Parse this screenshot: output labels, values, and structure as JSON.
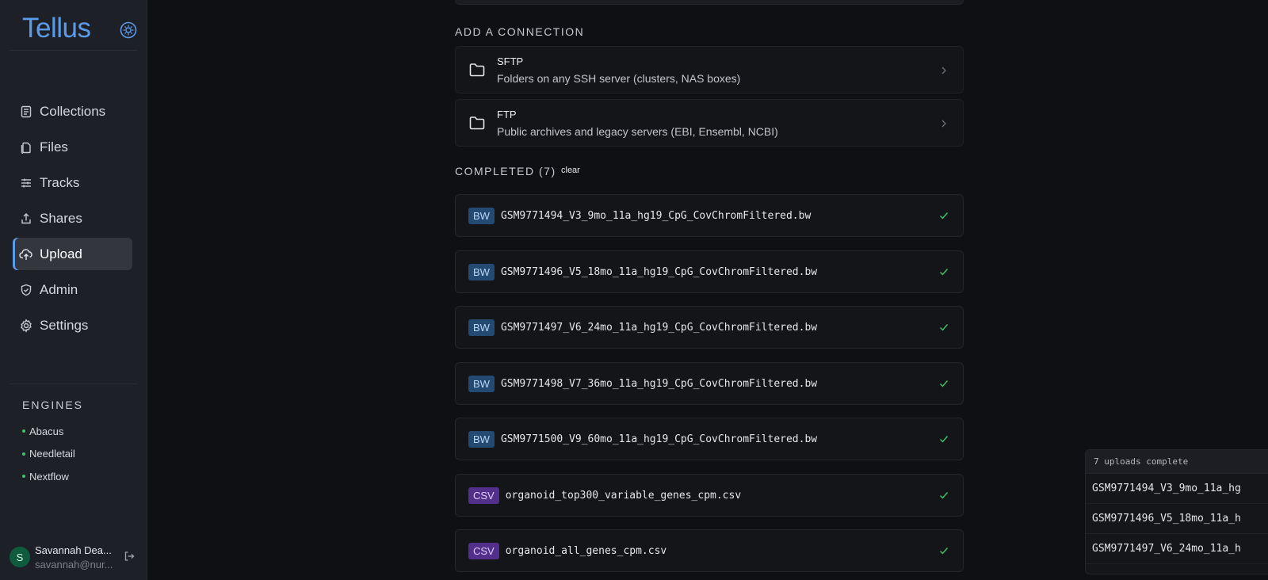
{
  "app": {
    "name": "Tellus"
  },
  "sidebar": {
    "nav": [
      {
        "label": "Collections",
        "icon": "collections-icon",
        "active": false
      },
      {
        "label": "Files",
        "icon": "files-icon",
        "active": false
      },
      {
        "label": "Tracks",
        "icon": "tracks-icon",
        "active": false
      },
      {
        "label": "Shares",
        "icon": "share-icon",
        "active": false
      },
      {
        "label": "Upload",
        "icon": "upload-cloud-icon",
        "active": true
      },
      {
        "label": "Admin",
        "icon": "shield-icon",
        "active": false
      },
      {
        "label": "Settings",
        "icon": "gear-icon",
        "active": false
      }
    ],
    "engines_title": "ENGINES",
    "engines": [
      "Abacus",
      "Needletail",
      "Nextflow"
    ],
    "user": {
      "initial": "S",
      "name": "Savannah Dea...",
      "email": "savannah@nur..."
    }
  },
  "main": {
    "add_connection_title": "ADD A CONNECTION",
    "connections": [
      {
        "title": "SFTP",
        "description": "Folders on any SSH server (clusters, NAS boxes)",
        "icon": "folder-icon"
      },
      {
        "title": "FTP",
        "description": "Public archives and legacy servers (EBI, Ensembl, NCBI)",
        "icon": "folder-icon"
      }
    ],
    "completed_title": "COMPLETED (7)",
    "clear_label": "clear",
    "files": [
      {
        "type": "BW",
        "name": "GSM9771494_V3_9mo_11a_hg19_CpG_CovChromFiltered.bw",
        "status": "check-icon"
      },
      {
        "type": "BW",
        "name": "GSM9771496_V5_18mo_11a_hg19_CpG_CovChromFiltered.bw",
        "status": "check-icon"
      },
      {
        "type": "BW",
        "name": "GSM9771497_V6_24mo_11a_hg19_CpG_CovChromFiltered.bw",
        "status": "check-icon"
      },
      {
        "type": "BW",
        "name": "GSM9771498_V7_36mo_11a_hg19_CpG_CovChromFiltered.bw",
        "status": "check-icon"
      },
      {
        "type": "BW",
        "name": "GSM9771500_V9_60mo_11a_hg19_CpG_CovChromFiltered.bw",
        "status": "check-icon"
      },
      {
        "type": "CSV",
        "name": "organoid_top300_variable_genes_cpm.csv",
        "status": "check-icon"
      },
      {
        "type": "CSV",
        "name": "organoid_all_genes_cpm.csv",
        "status": "check-icon"
      }
    ]
  },
  "toast": {
    "title": "7 uploads complete",
    "items": [
      "GSM9771494_V3_9mo_11a_hg",
      "GSM9771496_V5_18mo_11a_h",
      "GSM9771497_V6_24mo_11a_h"
    ]
  },
  "colors": {
    "accent": "#5b9bea",
    "success": "#3ec46d",
    "bw_badge": "#234a73",
    "csv_badge": "#512f8a"
  }
}
